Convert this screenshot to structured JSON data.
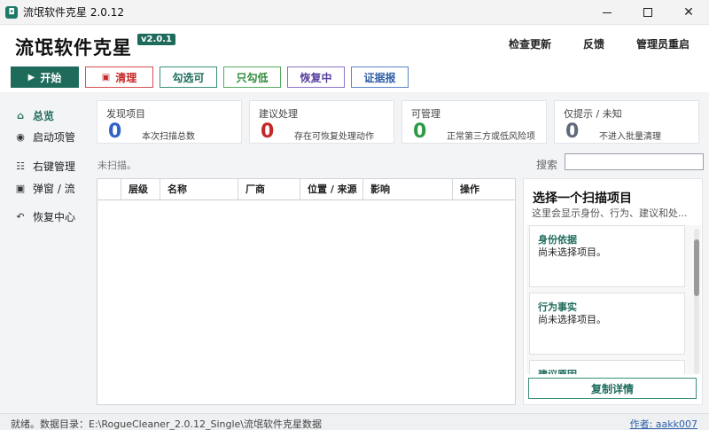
{
  "window": {
    "title": "流氓软件克星 2.0.12"
  },
  "header": {
    "app_title": "流氓软件克星",
    "version": "v2.0.1",
    "links": [
      "检查更新",
      "反馈",
      "管理员重启"
    ]
  },
  "toolbar": {
    "start": "开始",
    "clean": "清理",
    "check_selectable": "勾选可",
    "check_low": "只勾低",
    "restoring": "恢复中",
    "evidence": "证据报"
  },
  "sidebar": {
    "items": [
      {
        "label": "总览",
        "icon": "home-icon"
      },
      {
        "label": "启动项管",
        "icon": "radio-icon"
      },
      {
        "label": "右键管理",
        "icon": "list-icon"
      },
      {
        "label": "弹窗 / 流",
        "icon": "square-icon"
      },
      {
        "label": "恢复中心",
        "icon": "undo-icon"
      }
    ]
  },
  "cards": [
    {
      "label": "发现项目",
      "value": "0",
      "sub": "本次扫描总数",
      "color": "#2f63c4"
    },
    {
      "label": "建议处理",
      "value": "0",
      "sub": "存在可恢复处理动作",
      "color": "#c62828"
    },
    {
      "label": "可管理",
      "value": "0",
      "sub": "正常第三方或低风险项",
      "color": "#2e9a45"
    },
    {
      "label": "仅提示 / 未知",
      "value": "0",
      "sub": "不进入批量清理",
      "color": "#5f6b7a"
    }
  ],
  "main": {
    "status": "未扫描。",
    "search_label": "搜索",
    "search_value": "",
    "columns": [
      "层级",
      "名称",
      "厂商",
      "位置 / 来源",
      "影响",
      "操作"
    ]
  },
  "detail": {
    "title": "选择一个扫描项目",
    "subtitle": "这里会显示身份、行为、建议和处...",
    "sections": [
      {
        "title": "身份依据",
        "text": "尚未选择项目。"
      },
      {
        "title": "行为事实",
        "text": "尚未选择项目。"
      },
      {
        "title": "建议原因",
        "text": ""
      }
    ],
    "copy_button": "复制详情"
  },
  "statusbar": {
    "text": "就绪。数据目录：E:\\RogueCleaner_2.0.12_Single\\流氓软件克星数据",
    "author": "作者: aakk007"
  },
  "colors": {
    "accent": "#1e6b5c",
    "danger": "#c62828",
    "link": "#2f5fa8"
  }
}
